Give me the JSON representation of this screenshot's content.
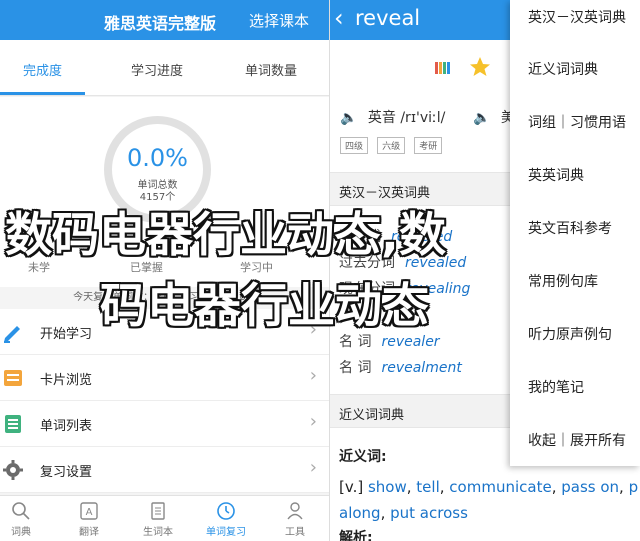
{
  "left": {
    "title": "雅思英语完整版",
    "action": "选择课本",
    "tabs": [
      "完成度",
      "学习进度",
      "单词数量"
    ],
    "progress": {
      "percent": "0.0%",
      "label": "单词总数",
      "count": "4157个"
    },
    "stats": [
      "未学",
      "已掌握",
      "学习中"
    ],
    "today": "今天复习单词数：0个，学习新词数：0个",
    "menu": [
      "开始学习",
      "卡片浏览",
      "单词列表",
      "复习设置"
    ],
    "nav": [
      "词典",
      "翻译",
      "生词本",
      "单词复习",
      "工具"
    ],
    "active_nav": "单词复习"
  },
  "right": {
    "word": "reveal",
    "phonetic_en_label": "英音",
    "phonetic_en": "/rɪ'viːl/",
    "phonetic_us_label": "美",
    "tags": [
      "四级",
      "六级",
      "考研"
    ],
    "section_main": "英汉－汉英词典",
    "forms": [
      {
        "label": "过去式",
        "value": "revealed"
      },
      {
        "label": "过去分词",
        "value": "revealed"
      },
      {
        "label": "现在分词",
        "value": "revealing"
      },
      {
        "label": "名  词",
        "value": "revealer"
      },
      {
        "label": "名  词",
        "value": "revealment"
      }
    ],
    "section_syn": "近义词词典",
    "syn_title": "近义词:",
    "syn_prefix": "[v.]",
    "syn_words": [
      "show",
      "tell",
      "communicate",
      "pass on",
      "p",
      "along",
      "put across"
    ],
    "exp_title": "解析:"
  },
  "dropdown": [
    "英汉－汉英词典",
    "近义词词典",
    "词组｜习惯用语",
    "英英词典",
    "英文百科参考",
    "常用例句库",
    "听力原声例句",
    "我的笔记",
    "收起｜展开所有"
  ],
  "watermark": {
    "line1": "数码电器行业动态,数",
    "line2": "码电器行业动态"
  },
  "colors": {
    "brand": "#2a92e6",
    "link": "#1a73c8"
  }
}
